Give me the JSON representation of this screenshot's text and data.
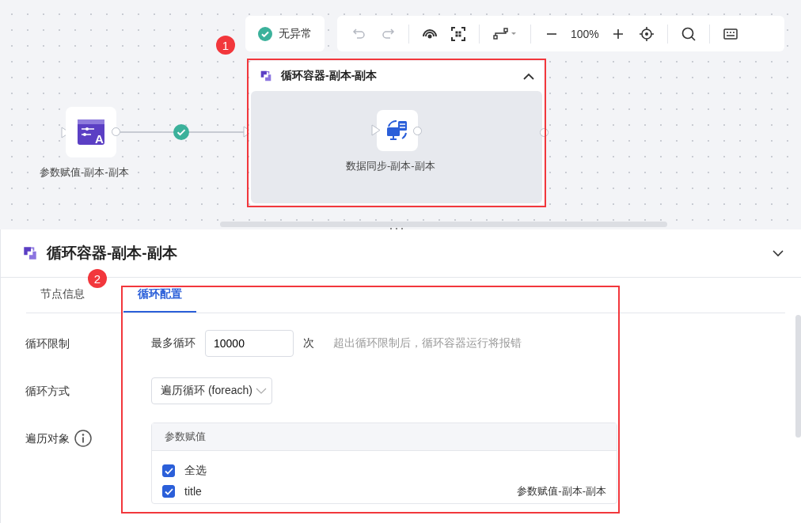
{
  "canvas": {
    "status": {
      "label": "无异常"
    },
    "toolbar": {
      "zoom": "100%"
    },
    "annotation": {
      "label": "1"
    },
    "nodes": [
      {
        "kind": "param",
        "icon_glyph": "A",
        "label": "参数赋值-副本-副本"
      }
    ],
    "container": {
      "title": "循环容器-副本-副本",
      "expanded": true,
      "child": {
        "label": "数据同步-副本-副本"
      }
    }
  },
  "panel": {
    "title": "循环容器-副本-副本",
    "expanded": true,
    "annotation": {
      "label": "2"
    },
    "tabs": [
      {
        "label": "节点信息",
        "selected": false
      },
      {
        "label": "循环配置",
        "selected": true
      }
    ],
    "fields": [
      {
        "kind": "limit",
        "label": "循环限制",
        "prefix": "最多循环",
        "value": "10000",
        "unit": "次",
        "hint": "超出循环限制后，循环容器运行将报错"
      },
      {
        "kind": "select",
        "label": "循环方式",
        "value": "遍历循环 (foreach)"
      },
      {
        "kind": "transfer",
        "label": "遍历对象",
        "group": "参数赋值",
        "items": [
          {
            "label": "全选",
            "checked": true
          },
          {
            "label": "title",
            "checked": true,
            "source": "参数赋值-副本-副本"
          }
        ]
      }
    ]
  }
}
